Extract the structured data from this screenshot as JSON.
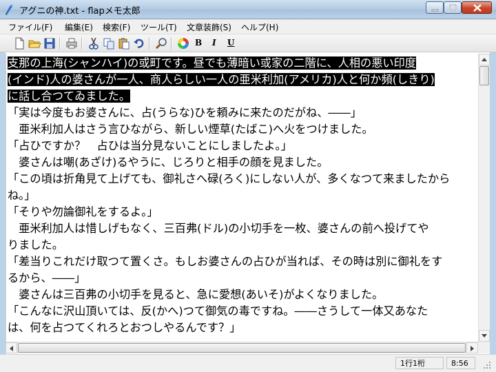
{
  "window": {
    "title": "アグニの神.txt - flapメモ太郎"
  },
  "menu": [
    {
      "label": "ファイル(F)"
    },
    {
      "label": "編集(E)"
    },
    {
      "label": "検索(F)"
    },
    {
      "label": "ツール(T)"
    },
    {
      "label": "文章装飾(S)"
    },
    {
      "label": "ヘルプ(H)"
    }
  ],
  "toolbar": {
    "icons": [
      "new-file-icon",
      "open-folder-icon",
      "save-icon",
      "print-icon",
      "cut-icon",
      "copy-icon",
      "paste-icon",
      "undo-icon",
      "search-icon",
      "color-icon",
      "bold-icon",
      "italic-icon",
      "underline-icon"
    ],
    "bold_label": "B",
    "italic_label": "I",
    "underline_label": "U"
  },
  "editor": {
    "lines": [
      {
        "text": "支那の上海(シャンハイ)の或町です。昼でも薄暗い或家の二階に、人相の悪い印度",
        "selected": true
      },
      {
        "text": "(インド)人の婆さんが一人、商人らしい一人の亜米利加(アメリカ)人と何か頻(しきり)",
        "selected": true
      },
      {
        "text": "に話し合つてゐました。",
        "selected": true
      },
      {
        "text": "「実は今度もお婆さんに、占(うらな)ひを頼みに来たのだがね、――」",
        "selected": false
      },
      {
        "text": "　亜米利加人はさう言ひながら、新しい煙草(たばこ)へ火をつけました。",
        "selected": false
      },
      {
        "text": "「占ひですか？　占ひは当分見ないことにしましたよ。」",
        "selected": false
      },
      {
        "text": "　婆さんは嘲(あざけ)るやうに、じろりと相手の顔を見ました。",
        "selected": false
      },
      {
        "text": "「この頃は折角見て上げても、御礼さへ碌(ろく)にしない人が、多くなつて来ましたから",
        "selected": false
      },
      {
        "text": "ね。」",
        "selected": false
      },
      {
        "text": "「そりや勿論御礼をするよ。」",
        "selected": false
      },
      {
        "text": "　亜米利加人は惜しげもなく、三百弗(ドル)の小切手を一枚、婆さんの前へ投げてや",
        "selected": false
      },
      {
        "text": "りました。",
        "selected": false
      },
      {
        "text": "「差当りこれだけ取つて置くさ。もしお婆さんの占ひが当れば、その時は別に御礼をす",
        "selected": false
      },
      {
        "text": "るから、――」",
        "selected": false
      },
      {
        "text": "　婆さんは三百弗の小切手を見ると、急に愛想(あいそ)がよくなりました。",
        "selected": false
      },
      {
        "text": "「こんなに沢山頂いては、反(かへ)つて御気の毒ですね。――さうして一体又あなた",
        "selected": false
      },
      {
        "text": "は、何を占つてくれろとおつしやるんです？」",
        "selected": false
      }
    ]
  },
  "status": {
    "position": "1行1桁",
    "time": "8:56"
  },
  "colors": {
    "selection_bg": "#000000",
    "selection_fg": "#ffffff",
    "titlebar": "#b6cde5"
  }
}
